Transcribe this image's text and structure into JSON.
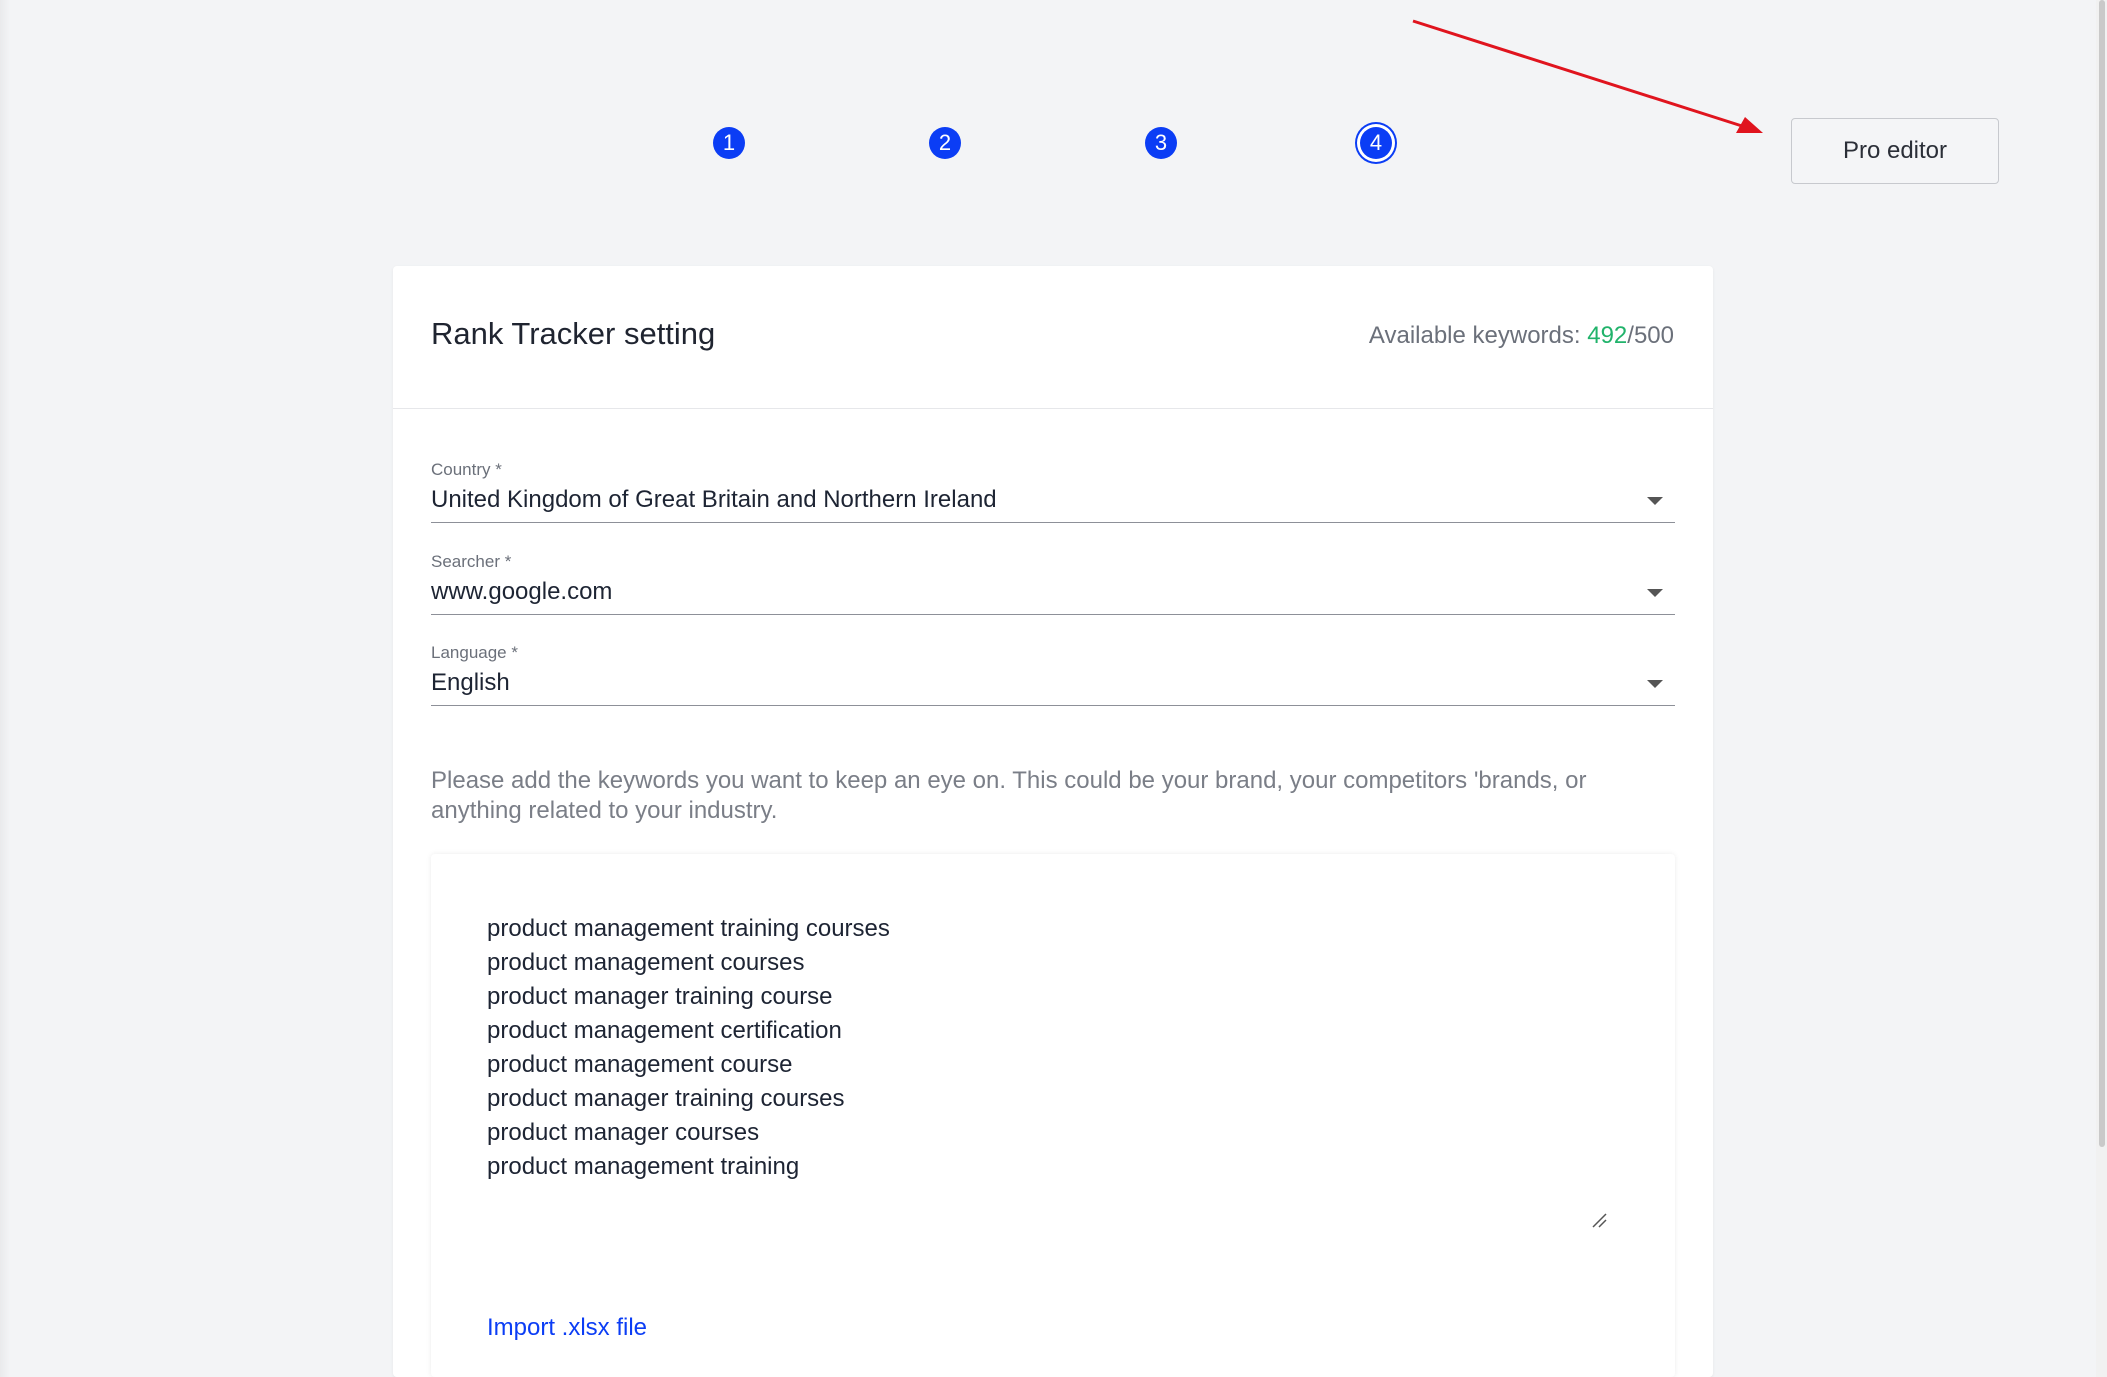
{
  "steps": [
    "1",
    "2",
    "3",
    "4"
  ],
  "header": {
    "pro_editor_label": "Pro editor"
  },
  "card": {
    "title": "Rank Tracker setting",
    "keywords_label": "Available keywords: ",
    "keywords_used": "492",
    "keywords_separator": "/",
    "keywords_total": "500"
  },
  "fields": {
    "country": {
      "label": "Country *",
      "value": "United Kingdom of Great Britain and Northern Ireland"
    },
    "searcher": {
      "label": "Searcher *",
      "value": "www.google.com"
    },
    "language": {
      "label": "Language *",
      "value": "English"
    }
  },
  "instructions": "Please add the keywords you want to keep an eye on. This could be your brand, your competitors 'brands, or anything related to your industry.",
  "keywords": [
    "product management training courses",
    "product management courses",
    "product manager training course",
    "product management certification",
    "product management course",
    "product manager training courses",
    "product manager courses",
    "product management training"
  ],
  "import_label": "Import .xlsx file",
  "colors": {
    "accent": "#0b3df5",
    "success": "#21b36b",
    "annotation_arrow": "#e0141e"
  }
}
